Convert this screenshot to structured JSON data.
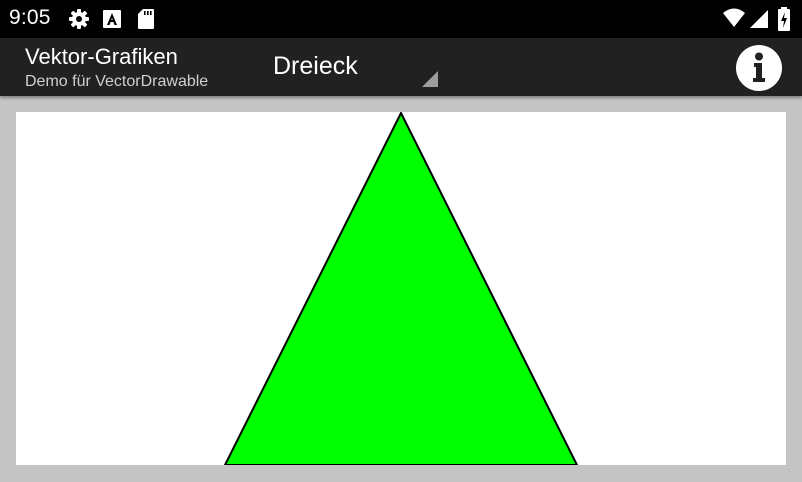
{
  "status_bar": {
    "time": "9:05",
    "left_icons": [
      "gear-icon",
      "font-a-icon",
      "sd-card-icon"
    ],
    "right_icons": [
      "wifi-icon",
      "signal-icon",
      "battery-charging-icon"
    ]
  },
  "app_bar": {
    "title": "Vektor-Grafiken",
    "subtitle": "Demo für VectorDrawable",
    "spinner": {
      "selected": "Dreieck"
    },
    "info_icon": "info-icon"
  },
  "drawing": {
    "shape": "triangle",
    "fill": "#00ff00",
    "stroke": "#000000",
    "background": "#ffffff"
  },
  "colors": {
    "status_bar": "#000000",
    "app_bar": "#212121",
    "frame": "#c4c4c4"
  }
}
